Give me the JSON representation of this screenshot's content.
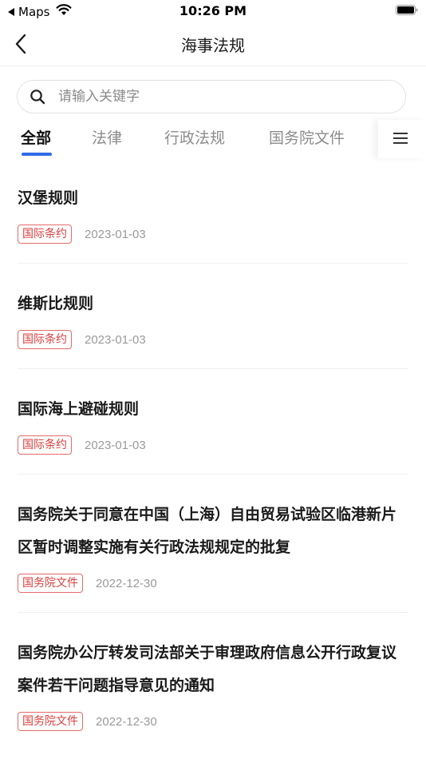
{
  "status_bar": {
    "back_app": "Maps",
    "time": "10:26 PM"
  },
  "nav": {
    "title": "海事法规"
  },
  "search": {
    "placeholder": "请输入关键字",
    "value": ""
  },
  "tabs": [
    {
      "label": "全部",
      "active": true
    },
    {
      "label": "法律",
      "active": false
    },
    {
      "label": "行政法规",
      "active": false
    },
    {
      "label": "国务院文件",
      "active": false
    }
  ],
  "colors": {
    "accent": "#2f6be6",
    "tag": "#d9403f"
  },
  "items": [
    {
      "title": "汉堡规则",
      "tag": "国际条约",
      "date": "2023-01-03"
    },
    {
      "title": "维斯比规则",
      "tag": "国际条约",
      "date": "2023-01-03"
    },
    {
      "title": "国际海上避碰规则",
      "tag": "国际条约",
      "date": "2023-01-03"
    },
    {
      "title": "国务院关于同意在中国（上海）自由贸易试验区临港新片区暂时调整实施有关行政法规规定的批复",
      "tag": "国务院文件",
      "date": "2022-12-30"
    },
    {
      "title": "国务院办公厅转发司法部关于审理政府信息公开行政复议案件若干问题指导意见的通知",
      "tag": "国务院文件",
      "date": "2022-12-30"
    }
  ]
}
